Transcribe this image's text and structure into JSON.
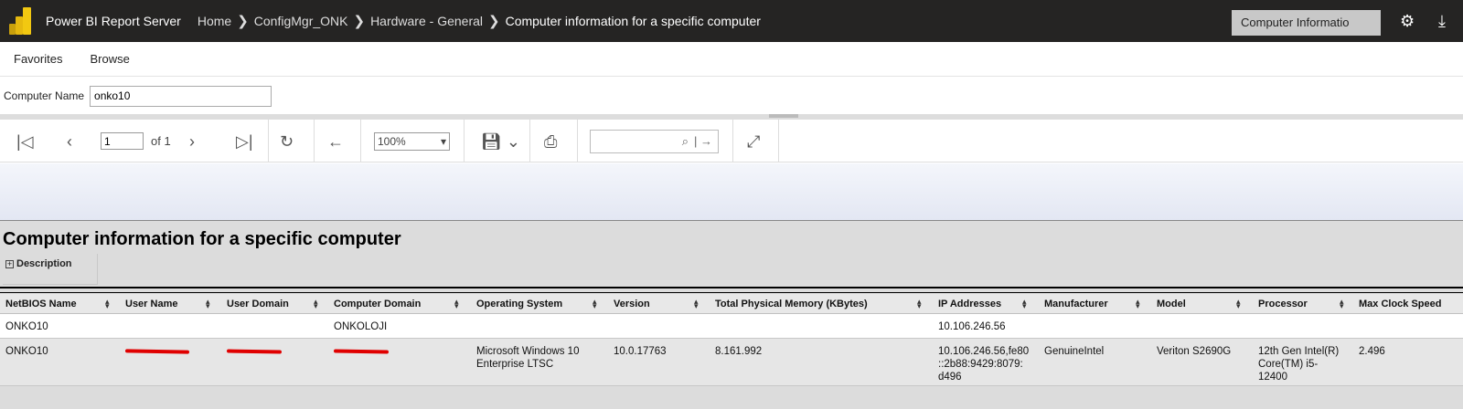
{
  "header": {
    "brand": "Power BI Report Server",
    "breadcrumbs": [
      "Home",
      "ConfigMgr_ONK",
      "Hardware - General",
      "Computer information for a specific computer"
    ],
    "search_value": "Computer Informatio",
    "icons": [
      "powerbi-logo-icon",
      "gear-icon",
      "download-icon"
    ]
  },
  "nav": {
    "favorites": "Favorites",
    "browse": "Browse"
  },
  "params": {
    "computer_name_label": "Computer Name",
    "computer_name_value": "onko10"
  },
  "toolbar": {
    "page_value": "1",
    "page_of": "of 1",
    "zoom": "100%",
    "find_placeholder": "",
    "icons": [
      "first-page-icon",
      "previous-page-icon",
      "next-page-icon",
      "last-page-icon",
      "refresh-icon",
      "back-icon",
      "save-icon",
      "print-icon",
      "find-icon",
      "find-next-icon",
      "fullscreen-icon"
    ]
  },
  "report": {
    "title": "Computer information for a specific computer",
    "description_label": "Description",
    "columns": [
      "NetBIOS Name",
      "User Name",
      "User Domain",
      "Computer Domain",
      "Operating System",
      "Version",
      "Total Physical Memory (KBytes)",
      "IP Addresses",
      "Manufacturer",
      "Model",
      "Processor",
      "Max Clock Speed"
    ],
    "rows": [
      {
        "netbios": "ONKO10",
        "computer_domain": "ONKOLOJI",
        "ip": "10.106.246.56"
      },
      {
        "netbios": "ONKO10",
        "os_line1": "Microsoft Windows 10",
        "os_line2": "Enterprise LTSC",
        "version": "10.0.17763",
        "memory": "8.161.992",
        "ip_line1": "10.106.246.56,fe80",
        "ip_line2": "::2b88:9429:8079:",
        "ip_line3": "d496",
        "manufacturer": "GenuineIntel",
        "model": "Veriton S2690G",
        "proc_line1": "12th Gen Intel(R)",
        "proc_line2": "Core(TM) i5-",
        "proc_line3": "12400",
        "clock": "2.496"
      }
    ]
  }
}
